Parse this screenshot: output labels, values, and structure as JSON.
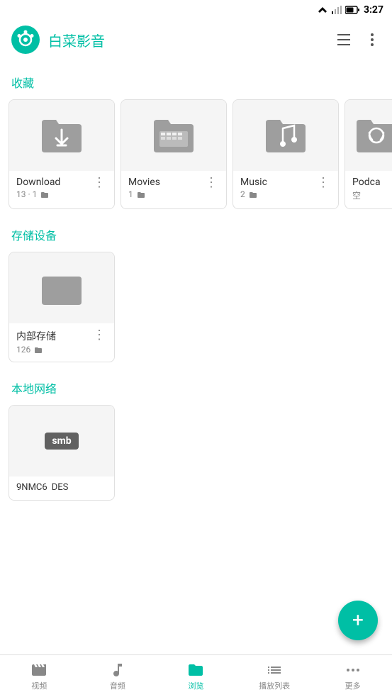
{
  "statusBar": {
    "time": "3:27"
  },
  "appBar": {
    "title": "白菜影音",
    "listViewIcon": "list-view-icon",
    "moreIcon": "more-vertical-icon"
  },
  "sections": {
    "favorites": {
      "title": "收藏",
      "folders": [
        {
          "name": "Download",
          "meta": "13 · 1",
          "type": "download"
        },
        {
          "name": "Movies",
          "meta": "1",
          "type": "movie"
        },
        {
          "name": "Music",
          "meta": "2",
          "type": "music"
        },
        {
          "name": "Podca",
          "meta": "空",
          "type": "podcast"
        }
      ]
    },
    "storage": {
      "title": "存储设备",
      "items": [
        {
          "name": "内部存储",
          "meta": "126",
          "type": "folder"
        }
      ]
    },
    "network": {
      "title": "本地网络",
      "items": [
        {
          "name": "9NMC6",
          "tag": "DES",
          "type": "smb"
        }
      ]
    }
  },
  "fab": {
    "label": "+"
  },
  "bottomNav": {
    "items": [
      {
        "label": "视频",
        "active": false
      },
      {
        "label": "音频",
        "active": false
      },
      {
        "label": "浏览",
        "active": true
      },
      {
        "label": "播放列表",
        "active": false
      },
      {
        "label": "更多",
        "active": false
      }
    ]
  }
}
